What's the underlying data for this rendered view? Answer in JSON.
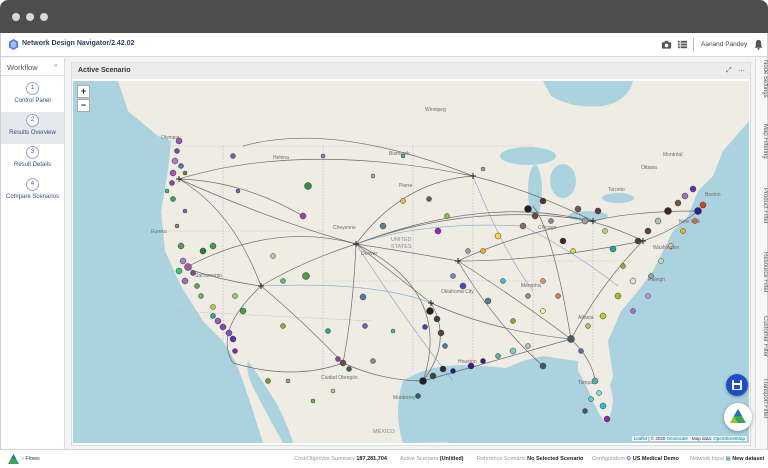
{
  "app": {
    "title": "Network Design Navigator/2.42.02",
    "user": "Aanand Pandey"
  },
  "workflow": {
    "title": "Workflow",
    "collapse_icon": "double-chevron-left-icon",
    "steps": [
      {
        "num": "1",
        "label": "Control Panel"
      },
      {
        "num": "2",
        "label": "Results Overview"
      },
      {
        "num": "3",
        "label": "Result Details"
      },
      {
        "num": "4",
        "label": "Compare Scenarios"
      }
    ],
    "active_step": 2
  },
  "panel": {
    "title": "Active Scenario"
  },
  "map": {
    "zoom_in": "+",
    "zoom_out": "−",
    "attribution": {
      "leaflet": "Leaflet",
      "copyright": "| © 2020",
      "omniscale": "Omniscale",
      "map_data_label": "· Map data:",
      "osm": "OpenStreetMap"
    },
    "labels": {
      "winnipeg": "Winnipeg",
      "helena": "Helena",
      "bismarck": "Bismarck",
      "pierre": "Pierre",
      "olympia": "Olympia",
      "eureka": "Eureka",
      "cheyenne": "Cheyenne",
      "united_states": "UNITED",
      "states_word": "STATES",
      "chicago": "Chicago",
      "toronto": "Toronto",
      "montreal": "Montréal",
      "ottawa": "Ottawa",
      "boston": "Boston",
      "new_york": "New York",
      "washington": "Washington",
      "oklahoma": "Oklahoma City",
      "memphis": "Memphis",
      "atlanta": "Atlanta",
      "houston": "Houston",
      "ciudad_obregon": "Ciudad Obregón",
      "monterrey": "Monterrey",
      "mexico": "MÉXICO",
      "tampa": "Tampa",
      "sacramento": "Sacramento",
      "denver": "Denver",
      "raleigh": "Raleigh"
    }
  },
  "rail": {
    "tabs": [
      "Node Settings",
      "Map Filtering",
      "Product Filter",
      "Resource Filter",
      "Customer Filter",
      "Transport Filter"
    ]
  },
  "statusbar": {
    "flows_label": "Flows",
    "cost_label": "Cost/Objective Summary",
    "cost_value": "187,281,704",
    "active_label": "Active Scenario",
    "active_value": "(Unlitled)",
    "reference_label": "Reference Scenario",
    "reference_value": "No Selected Scenario",
    "config_label": "Configuration",
    "config_value": "US Medical Demo",
    "network_label": "Network Input",
    "network_value": "New dataset"
  },
  "colors": {
    "titlebar": "#4d4d4d",
    "accent": "#2c3e66",
    "link": "#2d4e8f",
    "save_button": "#1f4fc8",
    "water": "#aad3df",
    "land": "#efece4"
  }
}
